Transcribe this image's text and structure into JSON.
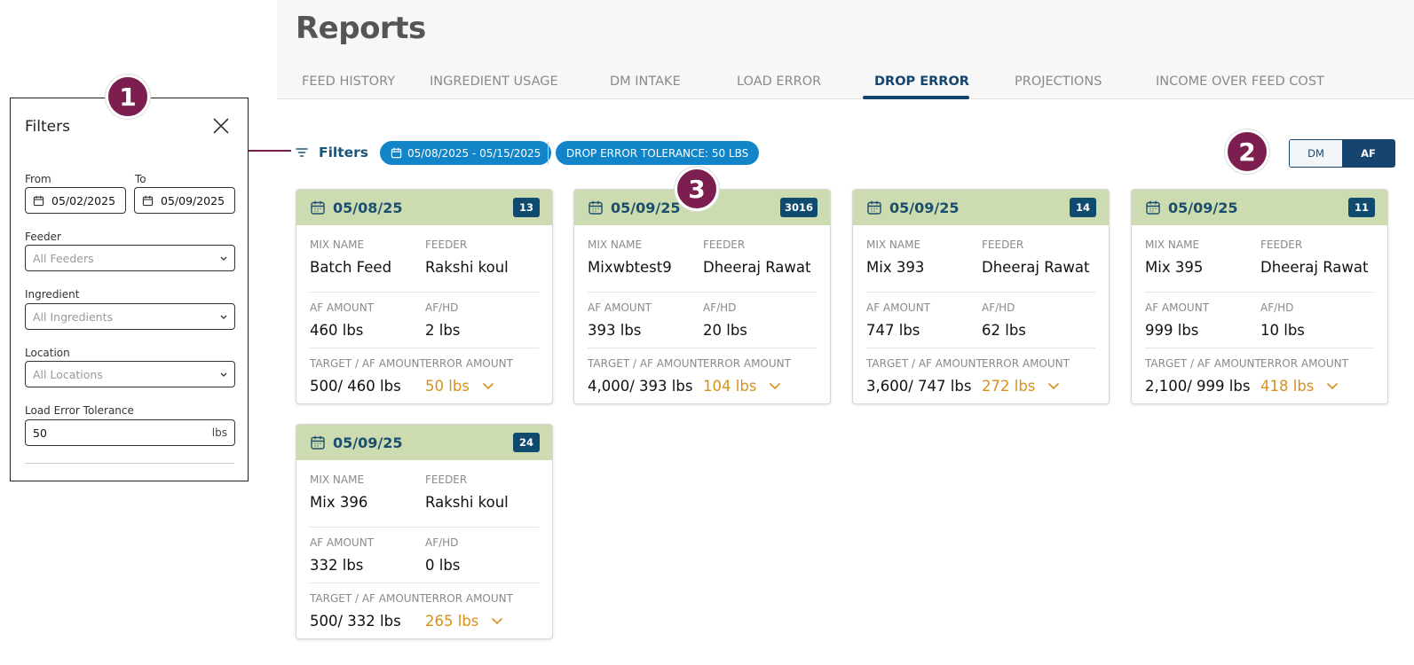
{
  "page": {
    "title": "Reports"
  },
  "tabs": [
    {
      "label": "FEED HISTORY"
    },
    {
      "label": "INGREDIENT USAGE"
    },
    {
      "label": "DM INTAKE"
    },
    {
      "label": "LOAD ERROR"
    },
    {
      "label": "DROP ERROR",
      "active": true
    },
    {
      "label": "PROJECTIONS"
    },
    {
      "label": "INCOME OVER FEED COST"
    }
  ],
  "filter_bar": {
    "filters_label": "Filters",
    "date_pill": "05/08/2025 - 05/15/2025",
    "tolerance_pill": "DROP ERROR TOLERANCE: 50 LBS"
  },
  "toggle": {
    "dm": "DM",
    "af": "AF",
    "selected": "AF"
  },
  "badges": {
    "one": "1",
    "two": "2",
    "three": "3"
  },
  "panel": {
    "title": "Filters",
    "from_label": "From",
    "from_value": "05/02/2025",
    "to_label": "To",
    "to_value": "05/09/2025",
    "feeder_label": "Feeder",
    "feeder_placeholder": "All Feeders",
    "ingredient_label": "Ingredient",
    "ingredient_placeholder": "All Ingredients",
    "location_label": "Location",
    "location_placeholder": "All Locations",
    "tolerance_label": "Load Error Tolerance",
    "tolerance_value": "50",
    "tolerance_unit": "lbs"
  },
  "card_labels": {
    "mix_name": "MIX NAME",
    "feeder": "FEEDER",
    "af_amount": "AF AMOUNT",
    "af_hd": "AF/HD",
    "target_af": "TARGET / AF AMOUNT",
    "error_amount": "ERROR AMOUNT"
  },
  "cards": [
    {
      "date": "05/08/25",
      "count": "13",
      "mix_name": "Batch Feed",
      "feeder": "Rakshi koul",
      "af_amount": "460 lbs",
      "af_hd": "2 lbs",
      "target_af": "500/ 460 lbs",
      "error_amount": "50 lbs"
    },
    {
      "date": "05/09/25",
      "count": "3016",
      "mix_name": "Mixwbtest9",
      "feeder": "Dheeraj Rawat",
      "af_amount": "393 lbs",
      "af_hd": "20 lbs",
      "target_af": "4,000/ 393 lbs",
      "error_amount": "104 lbs"
    },
    {
      "date": "05/09/25",
      "count": "14",
      "mix_name": "Mix 393",
      "feeder": "Dheeraj Rawat",
      "af_amount": "747 lbs",
      "af_hd": "62 lbs",
      "target_af": "3,600/ 747 lbs",
      "error_amount": "272 lbs"
    },
    {
      "date": "05/09/25",
      "count": "11",
      "mix_name": "Mix 395",
      "feeder": "Dheeraj Rawat",
      "af_amount": "999 lbs",
      "af_hd": "10 lbs",
      "target_af": "2,100/ 999 lbs",
      "error_amount": "418 lbs"
    },
    {
      "date": "05/09/25",
      "count": "24",
      "mix_name": "Mix 396",
      "feeder": "Rakshi koul",
      "af_amount": "332 lbs",
      "af_hd": "0 lbs",
      "target_af": "500/ 332 lbs",
      "error_amount": "265 lbs"
    }
  ],
  "colors": {
    "accent": "#15456e",
    "pill": "#1285c8",
    "card_header": "#cddcb0",
    "error_text": "#d6901b",
    "badge": "#7c1e4f"
  },
  "icons": {
    "filter": "filter-lines-icon",
    "calendar": "calendar-icon",
    "close": "close-icon",
    "chevron": "chevron-down-icon"
  }
}
